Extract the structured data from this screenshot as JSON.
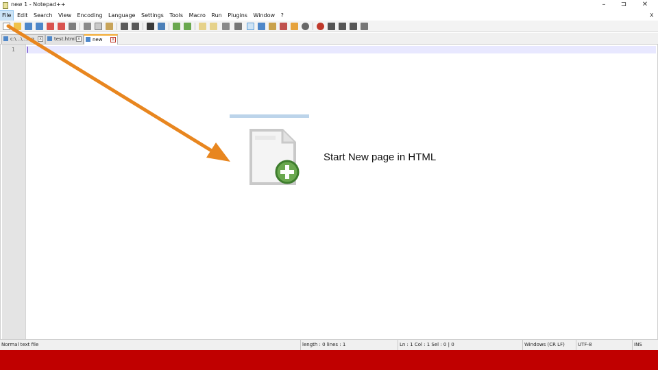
{
  "window": {
    "title": "new 1 - Notepad++",
    "minimize_glyph": "–",
    "restore_glyph": "⊐",
    "close_glyph": "✕"
  },
  "menu": {
    "items": [
      "File",
      "Edit",
      "Search",
      "View",
      "Encoding",
      "Language",
      "Settings",
      "Tools",
      "Macro",
      "Run",
      "Plugins",
      "Window",
      "?"
    ],
    "doc_close": "X"
  },
  "tabs": [
    {
      "label": "c:\\...\\...log",
      "active": false
    },
    {
      "label": "test.html",
      "active": false
    },
    {
      "label": "new",
      "active": true
    }
  ],
  "editor": {
    "line_numbers": [
      "1"
    ]
  },
  "status": {
    "file_type": "Normal text file",
    "length_lines": "length : 0    lines : 1",
    "position": "Ln : 1    Col : 1    Sel : 0 | 0",
    "eol": "Windows (CR LF)",
    "encoding": "UTF-8",
    "mode": "INS"
  },
  "annotation": {
    "caption": "Start New page in HTML",
    "arrow_color": "#e8861f"
  },
  "colors": {
    "bottom_bar": "#c00000",
    "active_tab_accent": "#f4a92e",
    "current_line": "#e8e8ff"
  }
}
